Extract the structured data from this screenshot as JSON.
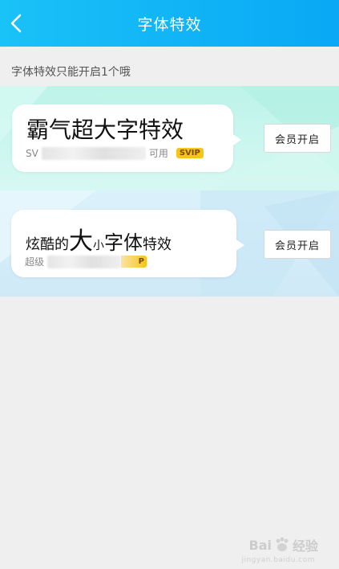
{
  "header": {
    "title": "字体特效",
    "back_icon": "chevron-left-icon",
    "background": "#12b6f6"
  },
  "notice": "字体特效只能开启1个哦",
  "effects": [
    {
      "preview_text": "霸气超大字特效",
      "subtitle_prefix": "SV",
      "subtitle_suffix": "可用",
      "badge": "SVIP",
      "button_label": "会员开启",
      "background": "#c8f6ee"
    },
    {
      "preview_parts": [
        "炫酷的",
        "大",
        "小",
        "字体",
        "特效"
      ],
      "subtitle_prefix": "超级",
      "badge": "P",
      "button_label": "会员开启",
      "background": "#d4ecf8"
    }
  ],
  "watermark": {
    "brand_left": "Bai",
    "brand_right": "经验",
    "url": "jingyan.baidu.com"
  }
}
